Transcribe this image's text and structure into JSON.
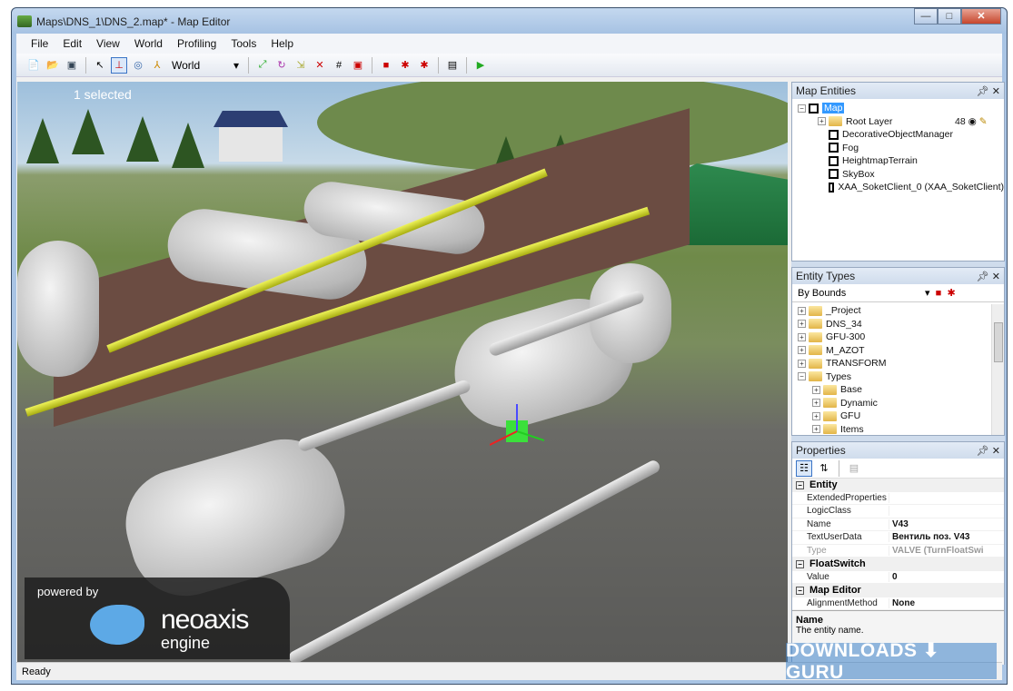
{
  "window": {
    "title": "Maps\\DNS_1\\DNS_2.map* - Map Editor",
    "minimize": "—",
    "maximize": "□",
    "close": "✕"
  },
  "menu": [
    {
      "label": "File",
      "u": "F"
    },
    {
      "label": "Edit",
      "u": "E"
    },
    {
      "label": "View",
      "u": "V"
    },
    {
      "label": "World",
      "u": "W"
    },
    {
      "label": "Profiling",
      "u": "P"
    },
    {
      "label": "Tools",
      "u": "T"
    },
    {
      "label": "Help",
      "u": "H"
    }
  ],
  "toolbar": {
    "coord_space": "World"
  },
  "viewport": {
    "selection_text": "1 selected",
    "logo": {
      "powered_by": "powered by",
      "brand": "neoaxis",
      "sub": "engine"
    }
  },
  "map_entities": {
    "title": "Map Entities",
    "items": [
      {
        "label": "Map",
        "selected": true
      },
      {
        "label": "Root Layer",
        "count": "48"
      },
      {
        "label": "DecorativeObjectManager"
      },
      {
        "label": "Fog"
      },
      {
        "label": "HeightmapTerrain"
      },
      {
        "label": "SkyBox"
      },
      {
        "label": "XAA_SoketClient_0 (XAA_SoketClient)"
      }
    ]
  },
  "entity_types": {
    "title": "Entity Types",
    "filter": "By Bounds",
    "items": [
      {
        "label": "_Project",
        "level": 0,
        "expanded": false
      },
      {
        "label": "DNS_34",
        "level": 0,
        "expanded": false
      },
      {
        "label": "GFU-300",
        "level": 0,
        "expanded": false
      },
      {
        "label": "M_AZOT",
        "level": 0,
        "expanded": false
      },
      {
        "label": "TRANSFORM",
        "level": 0,
        "expanded": false
      },
      {
        "label": "Types",
        "level": 0,
        "expanded": true
      },
      {
        "label": "Base",
        "level": 1,
        "expanded": false
      },
      {
        "label": "Dynamic",
        "level": 1,
        "expanded": false
      },
      {
        "label": "GFU",
        "level": 1,
        "expanded": false
      },
      {
        "label": "Items",
        "level": 1,
        "expanded": false
      }
    ]
  },
  "properties": {
    "title": "Properties",
    "entity": {
      "title": "Entity",
      "rows": [
        {
          "k": "ExtendedProperties",
          "v": ""
        },
        {
          "k": "LogicClass",
          "v": ""
        },
        {
          "k": "Name",
          "v": "V43"
        },
        {
          "k": "TextUserData",
          "v": "Вентиль поз. V43"
        },
        {
          "k": "Type",
          "v": "VALVE (TurnFloatSwi"
        }
      ]
    },
    "floatswitch": {
      "title": "FloatSwitch",
      "rows": [
        {
          "k": "Value",
          "v": "0"
        }
      ]
    },
    "mapeditor": {
      "title": "Map Editor",
      "rows": [
        {
          "k": "AlignmentMethod",
          "v": "None"
        }
      ]
    },
    "help_title": "Name",
    "help_text": "The entity name."
  },
  "status": "Ready",
  "watermark": "DOWNLOADS ⬇ GURU"
}
